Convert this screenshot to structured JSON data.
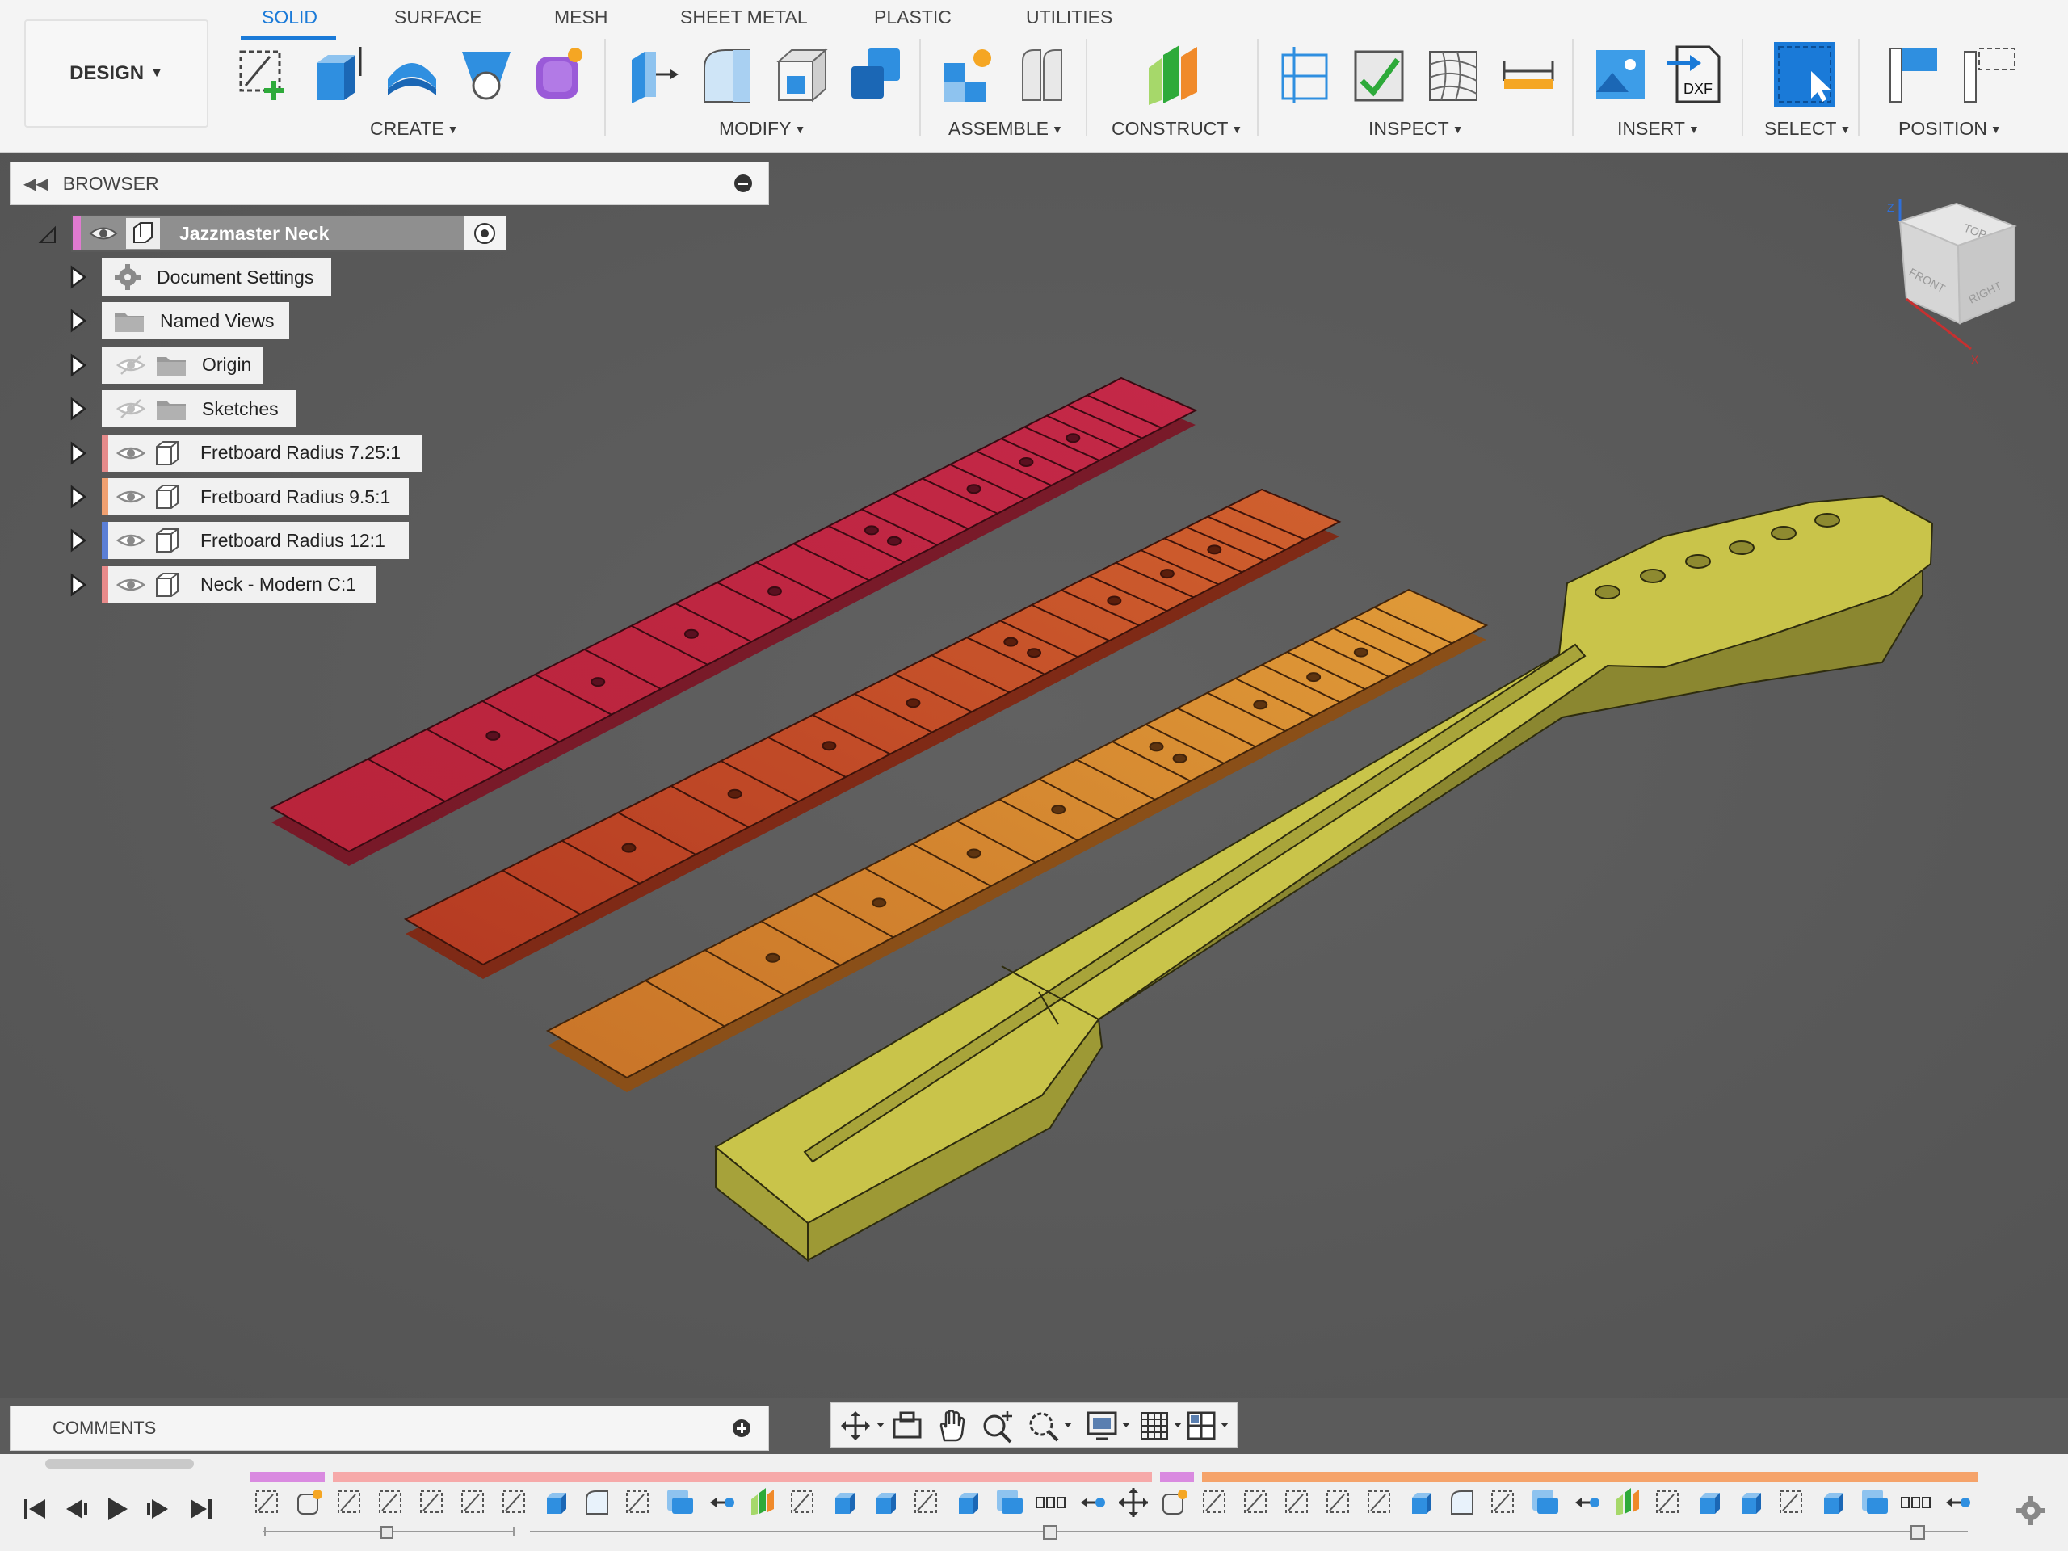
{
  "workspace": {
    "label": "DESIGN"
  },
  "tabs": [
    {
      "label": "SOLID",
      "active": true
    },
    {
      "label": "SURFACE"
    },
    {
      "label": "MESH"
    },
    {
      "label": "SHEET METAL"
    },
    {
      "label": "PLASTIC"
    },
    {
      "label": "UTILITIES"
    }
  ],
  "groups": [
    {
      "label": "CREATE",
      "tools": [
        "new-sketch-icon",
        "extrude-icon",
        "revolve-icon",
        "sweep-icon",
        "form-icon"
      ]
    },
    {
      "label": "MODIFY",
      "tools": [
        "press-pull-icon",
        "fillet-icon",
        "shell-icon",
        "combine-icon"
      ]
    },
    {
      "label": "ASSEMBLE",
      "tools": [
        "new-component-icon",
        "joint-icon"
      ]
    },
    {
      "label": "CONSTRUCT",
      "tools": [
        "offset-plane-icon"
      ]
    },
    {
      "label": "INSPECT",
      "tools": [
        "section-analysis-icon",
        "draft-analysis-icon",
        "zebra-analysis-icon",
        "measure-icon"
      ]
    },
    {
      "label": "INSERT",
      "tools": [
        "insert-image-icon",
        "insert-dxf-icon"
      ]
    },
    {
      "label": "SELECT",
      "tools": [
        "select-icon"
      ]
    },
    {
      "label": "POSITION",
      "tools": [
        "align-icon",
        "capture-position-icon"
      ]
    }
  ],
  "dxf_label": "DXF",
  "browser": {
    "title": "BROWSER",
    "root": "Jazzmaster Neck",
    "nodes": [
      {
        "label": "Document Settings",
        "icon": "gear-icon"
      },
      {
        "label": "Named Views",
        "icon": "folder-icon"
      },
      {
        "label": "Origin",
        "icon": "folder-icon",
        "hidden": true
      },
      {
        "label": "Sketches",
        "icon": "folder-icon",
        "hidden": true
      },
      {
        "label": "Fretboard Radius 7.25:1",
        "icon": "body-icon",
        "color": "#e58a8a"
      },
      {
        "label": "Fretboard Radius 9.5:1",
        "icon": "body-icon",
        "color": "#f0a070"
      },
      {
        "label": "Fretboard Radius 12:1",
        "icon": "body-icon",
        "color": "#5b7fd6"
      },
      {
        "label": "Neck - Modern C:1",
        "icon": "body-icon",
        "color": "#e88a8a"
      }
    ]
  },
  "comments": {
    "title": "COMMENTS"
  },
  "colors": {
    "accent": "#1a7ad8",
    "viewport": "#5b5b5b",
    "fretboard_725": "#b8243a",
    "fretboard_95": "#c9502a",
    "fretboard_12": "#d8892e",
    "neck": "#c9c44a"
  },
  "viewcube": {
    "faces": [
      "TOP",
      "FRONT",
      "RIGHT"
    ],
    "axis_z": "Z",
    "axis_x": "X"
  }
}
